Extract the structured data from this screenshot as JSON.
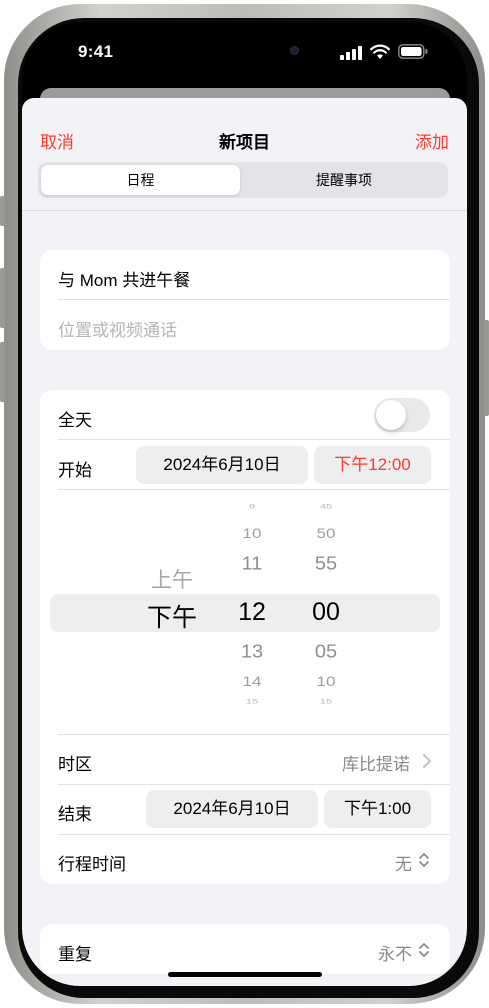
{
  "status": {
    "time": "9:41"
  },
  "nav": {
    "cancel": "取消",
    "title": "新项目",
    "add": "添加"
  },
  "segments": {
    "event": "日程",
    "reminder": "提醒事项",
    "selected": "日程"
  },
  "event": {
    "title_value": "与 Mom 共进午餐",
    "location_placeholder": "位置或视频通话"
  },
  "allday": {
    "label": "全天",
    "on": false
  },
  "start": {
    "label": "开始",
    "date": "2024年6月10日",
    "time": "下午12:00"
  },
  "picker": {
    "ampm": [
      "上午",
      "下午"
    ],
    "hours": [
      "9",
      "10",
      "11",
      "12",
      "13",
      "14",
      "15"
    ],
    "minutes": [
      "45",
      "50",
      "55",
      "00",
      "05",
      "10",
      "15"
    ]
  },
  "timezone": {
    "label": "时区",
    "value": "库比提诺"
  },
  "end": {
    "label": "结束",
    "date": "2024年6月10日",
    "time": "下午1:00"
  },
  "travel": {
    "label": "行程时间",
    "value": "无"
  },
  "repeat": {
    "label": "重复",
    "value": "永不"
  },
  "colors": {
    "accent": "#ff3b30",
    "background": "#f2f2f7",
    "card": "#ffffff"
  }
}
